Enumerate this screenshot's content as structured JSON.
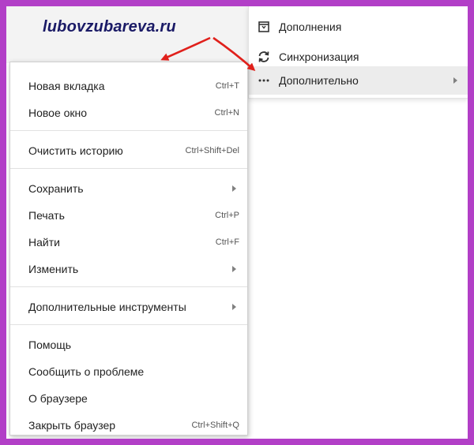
{
  "watermark": "lubovzubareva.ru",
  "submenu": {
    "items": [
      {
        "label": "Дополнения",
        "icon": "extensions-icon"
      },
      {
        "label": "Синхронизация",
        "icon": "sync-icon"
      },
      {
        "label": "Дополнительно",
        "icon": "more-dots-icon"
      }
    ]
  },
  "menu": {
    "items": [
      {
        "label": "Новая вкладка",
        "shortcut": "Ctrl+T"
      },
      {
        "label": "Новое окно",
        "shortcut": "Ctrl+N"
      },
      {
        "label": "Очистить историю",
        "shortcut": "Ctrl+Shift+Del"
      },
      {
        "label": "Сохранить",
        "shortcut": ""
      },
      {
        "label": "Печать",
        "shortcut": "Ctrl+P"
      },
      {
        "label": "Найти",
        "shortcut": "Ctrl+F"
      },
      {
        "label": "Изменить",
        "shortcut": ""
      },
      {
        "label": "Дополнительные инструменты",
        "shortcut": ""
      },
      {
        "label": "Помощь",
        "shortcut": ""
      },
      {
        "label": "Сообщить о проблеме",
        "shortcut": ""
      },
      {
        "label": "О браузере",
        "shortcut": ""
      },
      {
        "label": "Закрыть браузер",
        "shortcut": "Ctrl+Shift+Q"
      }
    ]
  },
  "colors": {
    "frame": "#b23fc7",
    "arrow": "#e0201b",
    "watermark": "#1a1a66"
  }
}
